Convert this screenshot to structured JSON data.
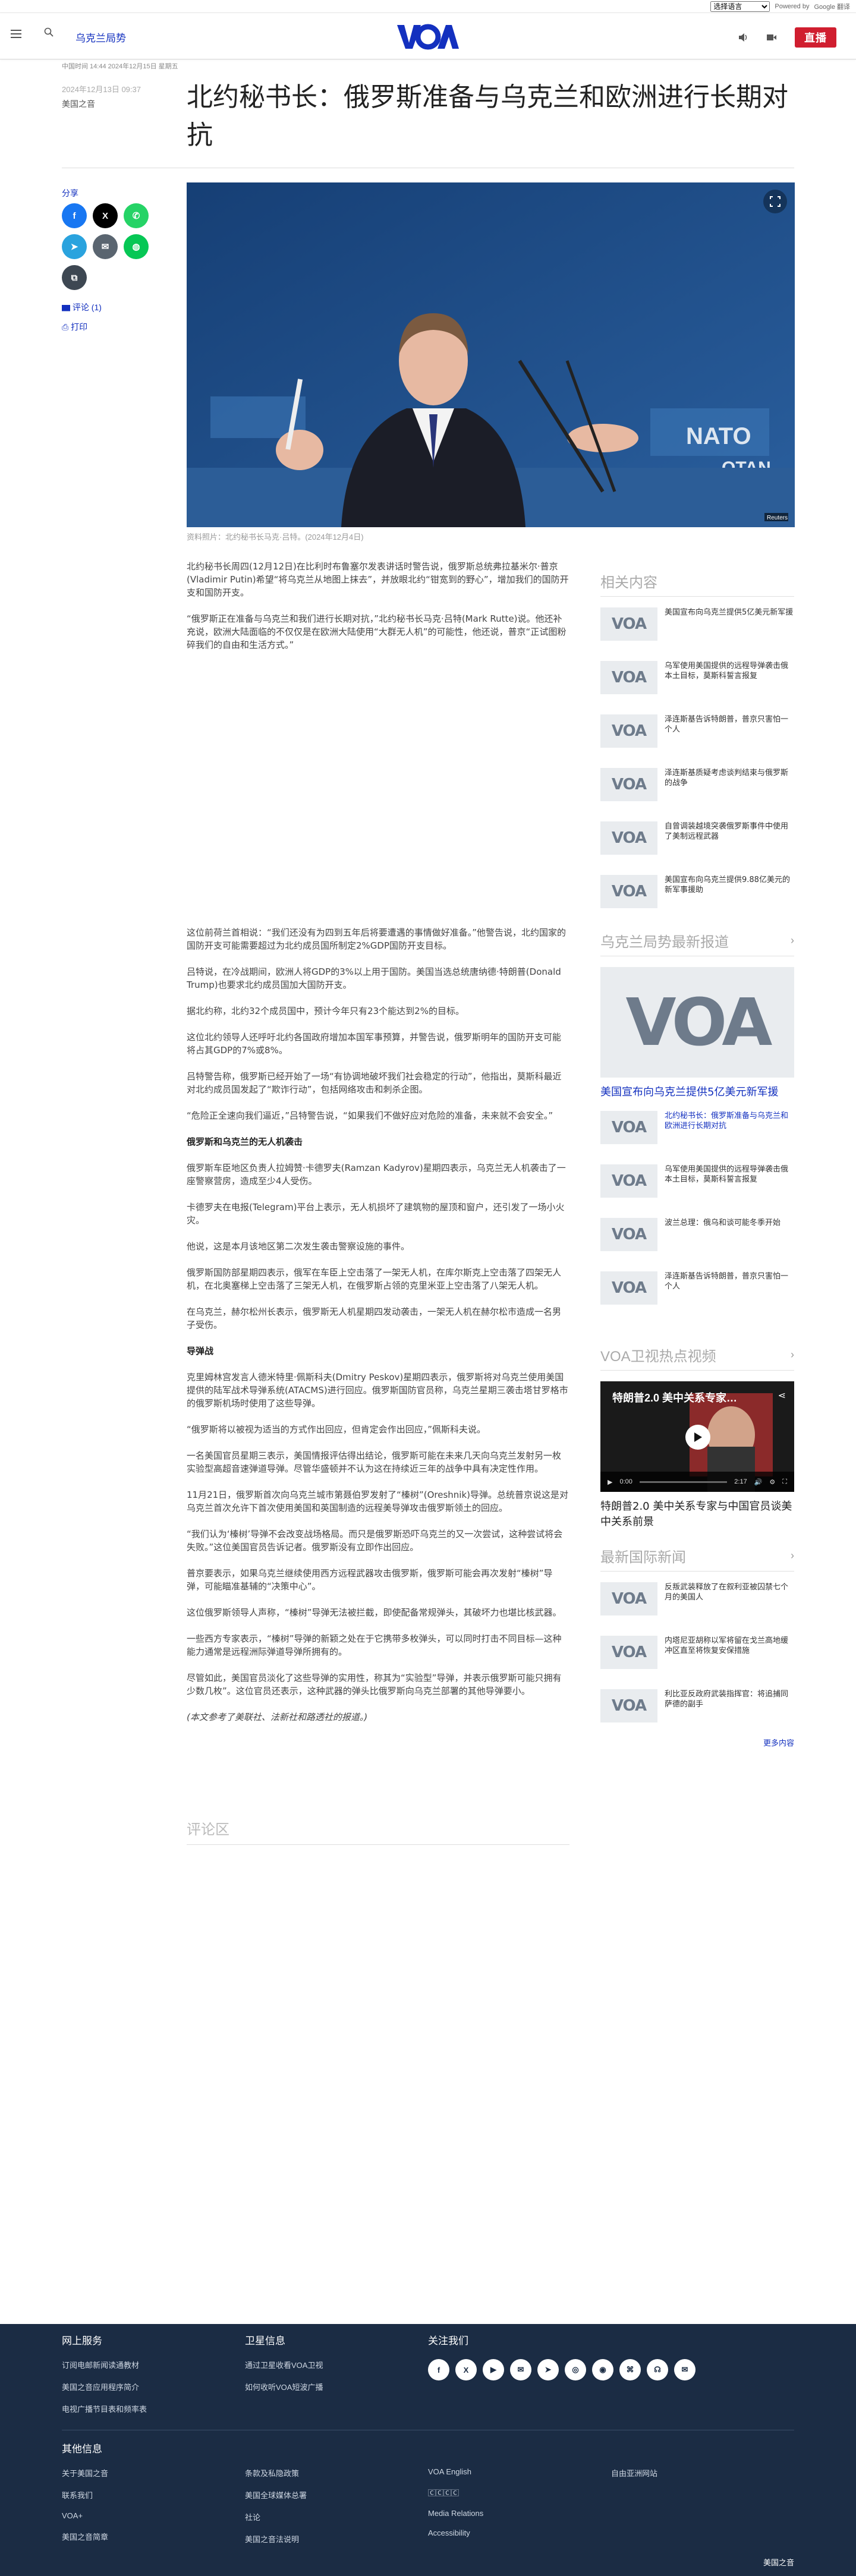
{
  "translate": {
    "select": "选择语言",
    "powered": "Powered by",
    "google": "Google 翻译"
  },
  "header": {
    "section": "乌克兰局势",
    "logo": "VOA",
    "live": "直播"
  },
  "dateline": "中国时间 14:44 2024年12月15日 星期五",
  "article": {
    "date": "2024年12月13日 09:37",
    "author": "美国之音",
    "headline": "北约秘书长：俄罗斯准备与乌克兰和欧洲进行长期对抗",
    "share_label": "分享",
    "comment_link": "评论 (1)",
    "print_link": "打印",
    "photo_credit": "Reuters",
    "caption": "资料照片：北约秘书长马克·吕特。(2024年12月4日)",
    "paragraphs_a": [
      "北约秘书长周四(12月12日)在比利时布鲁塞尔发表讲话时警告说，俄罗斯总统弗拉基米尔·普京(Vladimir Putin)希望“将乌克兰从地图上抹去”，并放眼北约“钳宽到的野心”，增加我们的国防开支和国防开支。",
      "“俄罗斯正在准备与乌克兰和我们进行长期对抗，”北约秘书长马克·吕特(Mark Rutte)说。他还补充说，欧洲大陆面临的不仅仅是在欧洲大陆使用“大群无人机”的可能性，他还说，普京“正试图粉碎我们的自由和生活方式。”"
    ],
    "paragraphs_b": [
      "这位前荷兰首相说：“我们还没有为四到五年后将要遭遇的事情做好准备。”他警告说，北约国家的国防开支可能需要超过为北约成员国所制定2%GDP国防开支目标。",
      "吕特说，在冷战期间，欧洲人将GDP的3%以上用于国防。美国当选总统唐纳德·特朗普(Donald Trump)也要求北约成员国加大国防开支。",
      "据北约称，北约32个成员国中，预计今年只有23个能达到2%的目标。",
      "这位北约领导人还呼吁北约各国政府增加本国军事预算，并警告说，俄罗斯明年的国防开支可能将占其GDP的7%或8%。",
      "吕特警告称，俄罗斯已经开始了一场“有协调地破坏我们社会稳定的行动”，他指出，莫斯科最近对北约成员国发起了“欺诈行动”，包括网络攻击和刺杀企图。",
      "“危险正全速向我们逼近，”吕特警告说，“如果我们不做好应对危险的准备，未来就不会安全。”"
    ],
    "subhead_1": "俄罗斯和乌克兰的无人机袭击",
    "paragraphs_c": [
      "俄罗斯车臣地区负责人拉姆赞·卡德罗夫(Ramzan Kadyrov)星期四表示，乌克兰无人机袭击了一座警察营房，造成至少4人受伤。",
      "卡德罗夫在电报(Telegram)平台上表示，无人机损坏了建筑物的屋顶和窗户，还引发了一场小火灾。",
      "他说，这是本月该地区第二次发生袭击警察设施的事件。",
      "俄罗斯国防部星期四表示，俄军在车臣上空击落了一架无人机，在库尔斯克上空击落了四架无人机，在北奥塞梯上空击落了三架无人机，在俄罗斯占领的克里米亚上空击落了八架无人机。",
      "在乌克兰，赫尔松州长表示，俄罗斯无人机星期四发动袭击，一架无人机在赫尔松市造成一名男子受伤。"
    ],
    "subhead_2": "导弹战",
    "paragraphs_d": [
      "克里姆林宫发言人德米特里·佩斯科夫(Dmitry Peskov)星期四表示，俄罗斯将对乌克兰使用美国提供的陆军战术导弹系统(ATACMS)进行回应。俄罗斯国防官员称，乌克兰星期三袭击塔甘罗格市的俄罗斯机场时使用了这些导弹。",
      "“俄罗斯将以被视为适当的方式作出回应，但肯定会作出回应，”佩斯科夫说。",
      "一名美国官员星期三表示，美国情报评估得出结论，俄罗斯可能在未来几天向乌克兰发射另一枚实验型高超音速弹道导弹。尽管华盛顿并不认为这在持续近三年的战争中具有决定性作用。",
      "11月21日，俄罗斯首次向乌克兰城市第聂伯罗发射了“榛树”(Oreshnik)导弹。总统普京说这是对乌克兰首次允许下首次使用美国和英国制造的远程美导弹攻击俄罗斯领土的回应。",
      "“我们认为‘榛树’导弹不会改变战场格局。而只是俄罗斯恐吓乌克兰的又一次尝试，这种尝试将会失败。”这位美国官员告诉记者。俄罗斯没有立即作出回应。",
      "普京要表示，如果乌克兰继续使用西方远程武器攻击俄罗斯，俄罗斯可能会再次发射“榛树”导弹，可能瞄准基辅的“决策中心”。",
      "这位俄罗斯领导人声称，“榛树”导弹无法被拦截，即使配备常规弹头，其破坏力也堪比核武器。",
      "一些西方专家表示，“榛树”导弹的新颖之处在于它携带多枚弹头，可以同时打击不同目标—这种能力通常是远程洲际弹道导弹所拥有的。",
      "尽管如此，美国官员淡化了这些导弹的实用性，称其为“实验型”导弹，并表示俄罗斯可能只拥有少数几枚”。这位官员还表示，这种武器的弹头比俄罗斯向乌克兰部署的其他导弹要小。"
    ],
    "note": "(本文参考了美联社、法新社和路透社的报道。)",
    "comments_title": "评论区"
  },
  "sidebar": {
    "related_title": "相关内容",
    "related": [
      "美国宣布向乌克兰提供5亿美元新军援",
      "乌军使用美国提供的远程导弹袭击俄本土目标，莫斯科誓言报复",
      "泽连斯基告诉特朗普，普京只害怕一个人",
      "泽连斯基质疑考虑谈判结束与俄罗斯的战争",
      "自曾调装越境突袭俄罗斯事件中使用了美制远程武器",
      "美国宣布向乌克兰提供9.88亿美元的新军事援助"
    ],
    "news_title": "乌克兰局势最新报道",
    "news_feature": "美国宣布向乌克兰提供5亿美元新军援",
    "news": [
      "北约秘书长：俄罗斯准备与乌克兰和欧洲进行长期对抗",
      "乌军使用美国提供的远程导弹袭击俄本土目标，莫斯科誓言报复",
      "波兰总理：俄乌和谈可能冬季开始",
      "泽连斯基告诉特朗普，普京只害怕一个人"
    ],
    "video_title_label": "VOA卫视热点视频",
    "video_overlay": "特朗普2.0 美中关系专家…",
    "video_time_now": "0:00",
    "video_time_total": "2:17",
    "video_progress": 0.0,
    "video_caption": "特朗普2.0 美中关系专家与中国官员谈美中关系前景",
    "intl_title": "最新国际新闻",
    "intl": [
      "反叛武装释放了在叙利亚被囚禁七个月的美国人",
      "内塔尼亚胡称以军将留在戈兰高地缓冲区直至将恢复安保措施",
      "利比亚反政府武装指挥官：将追捕同萨德的副手"
    ],
    "more_news": "更多内容"
  },
  "footer": {
    "online_title": "网上服务",
    "online": [
      "订阅电邮新闻读通教材",
      "美国之音应用程序简介",
      "电视广播节目表和频率表"
    ],
    "sat_title": "卫星信息",
    "sat": [
      "通过卫星收看VOA卫视",
      "如何收听VOA短波广播"
    ],
    "follow_title": "关注我们",
    "social": [
      "f",
      "X",
      "▶",
      "✉",
      "➤",
      "◎",
      "◉",
      "⌘",
      "☊",
      "✉"
    ],
    "other_title": "其他信息",
    "col1": [
      "关于美国之音",
      "联系我们",
      "VOA+",
      "美国之音简章"
    ],
    "col2": [
      "条款及私隐政策",
      "美国全球媒体总署",
      "社论",
      "美国之音法说明"
    ],
    "col3": [
      "VOA English",
      "🄲🄲🄲🄲",
      "Media Relations",
      "Accessibility"
    ],
    "col4": [
      "自由亚洲网站"
    ],
    "copyright": "美国之音"
  }
}
